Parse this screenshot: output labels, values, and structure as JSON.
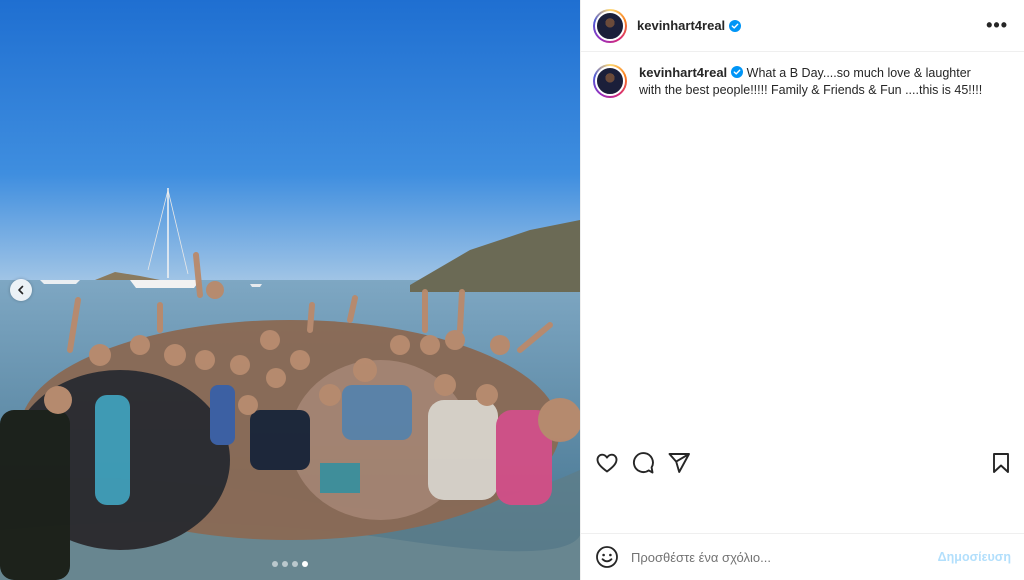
{
  "post": {
    "username": "kevinhart4real",
    "verified": true,
    "caption_username": "kevinhart4real",
    "caption_text": "What a B Day....so much love & laughter with the best people!!!!! Family & Friends & Fun ....this is 45!!!!",
    "more_icon": "more-horizontal-icon"
  },
  "media": {
    "carousel_total": 4,
    "carousel_active": 4,
    "prev_icon": "chevron-left-icon"
  },
  "actions": {
    "icons": [
      "heart-icon",
      "comment-icon",
      "share-icon",
      "bookmark-icon"
    ]
  },
  "comment": {
    "placeholder": "Προσθέστε ένα σχόλιο...",
    "post_label": "Δημοσίευση",
    "emoji_icon": "emoji-icon"
  },
  "colors": {
    "verified_blue": "#0095f6",
    "post_button_disabled": "#b2dffc",
    "sky_top": "#1f6fd1",
    "sea": "#5f95b3"
  }
}
